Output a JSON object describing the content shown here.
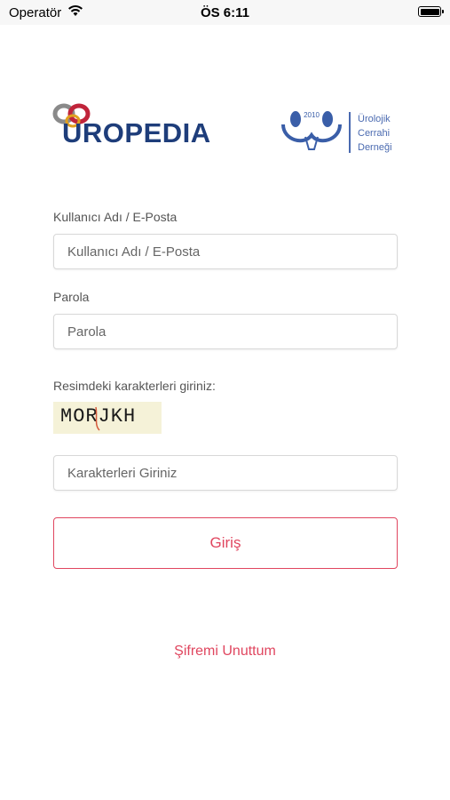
{
  "status_bar": {
    "carrier": "Operatör",
    "time": "ÖS 6:11",
    "battery_level": 1.0
  },
  "logos": {
    "uropedia": "UROPEDIA",
    "ucd_year": "2010",
    "ucd_lines": [
      "Ürolojik",
      "Cerrahi",
      "Derneği"
    ]
  },
  "form": {
    "username_label": "Kullanıcı Adı / E-Posta",
    "username_placeholder": "Kullanıcı Adı / E-Posta",
    "password_label": "Parola",
    "password_placeholder": "Parola",
    "captcha_label": "Resimdeki karakterleri giriniz:",
    "captcha_text": "MORJKH",
    "captcha_placeholder": "Karakterleri Giriniz",
    "login_button": "Giriş",
    "forgot_password": "Şifremi Unuttum"
  },
  "colors": {
    "accent": "#e0465f",
    "brand_blue": "#1e3d7a",
    "ucd_blue": "#4a6ab0"
  }
}
